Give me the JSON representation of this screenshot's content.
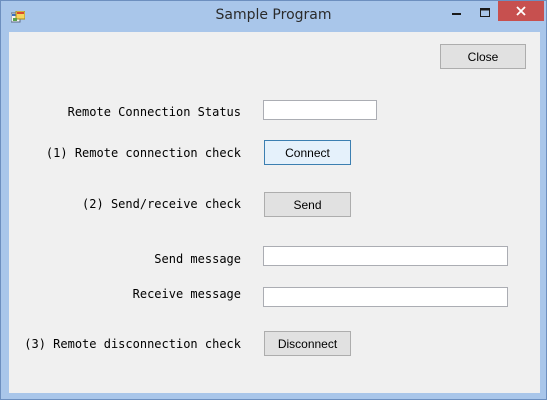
{
  "window": {
    "title": "Sample Program",
    "icon": "windows-form-app-icon"
  },
  "titlebar_buttons": {
    "minimize_icon": "minimize-icon",
    "maximize_icon": "maximize-icon",
    "close_icon": "close-icon"
  },
  "close_button": {
    "label": "Close"
  },
  "status": {
    "label": "Remote Connection Status",
    "value": ""
  },
  "connect_check": {
    "label": "(1) Remote connection check",
    "button": "Connect"
  },
  "send_check": {
    "label": "(2) Send/receive check",
    "button": "Send"
  },
  "send_message": {
    "label": "Send message",
    "value": ""
  },
  "receive_message": {
    "label": "Receive message",
    "value": ""
  },
  "disconnect_check": {
    "label": "(3) Remote disconnection check",
    "button": "Disconnect"
  },
  "colors": {
    "titlebar": "#a9c6ea",
    "close_hover": "#c7504f",
    "client_bg": "#f0f0f0"
  }
}
